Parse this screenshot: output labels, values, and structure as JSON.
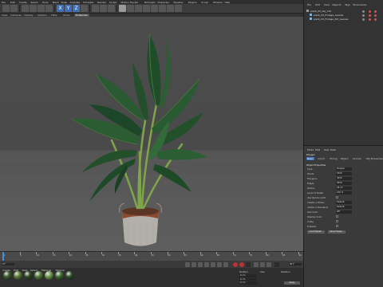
{
  "menus": [
    "File",
    "Edit",
    "Create",
    "Select",
    "Tools",
    "Mesh",
    "Snap",
    "Animate",
    "Simulate",
    "Render",
    "Sculpt",
    "Motion Tracker",
    "MoGraph",
    "Character",
    "Pipeline",
    "Plugins",
    "Script",
    "Window",
    "Help"
  ],
  "toolbar": {
    "x_label": "X",
    "y_label": "Y",
    "z_label": "Z"
  },
  "viewport": {
    "tabs": [
      "View",
      "Cameras",
      "Display",
      "Options",
      "Filter",
      "Panel",
      "ProRender"
    ],
    "active_tab": "ProRender"
  },
  "object_manager": {
    "menus": [
      "File",
      "Edit",
      "View",
      "Objects",
      "Tags",
      "Bookmarks"
    ],
    "objects": [
      {
        "name": "plant_03_obj_c4d",
        "indent": 0
      },
      {
        "name": "plant_03_Foliage_Leaves",
        "indent": 1
      },
      {
        "name": "plant_03_Foliage_Pot_Leaves",
        "indent": 1
      }
    ]
  },
  "attributes": {
    "menus": [
      "Mode",
      "Edit",
      "User Data"
    ],
    "object_title": "Polygon",
    "tabs": [
      "Basic",
      "Coord.",
      "Phong",
      "Object",
      "Include",
      "Obj.Properties"
    ],
    "active_tab": "Basic",
    "section_title": "Object Properties",
    "rows": [
      {
        "label": "Type",
        "value": "Polygon"
      },
      {
        "label": "Points",
        "value": "5340"
      },
      {
        "label": "Polygons",
        "value": "4200"
      },
      {
        "label": "Edges",
        "value": "9540"
      },
      {
        "label": "Radius",
        "value": "28 cm"
      },
      {
        "label": "Level of Detail",
        "value": "100 %"
      },
      {
        "label": "Use Render LOD",
        "value": ""
      },
      {
        "label": "Visible in Editor",
        "value": "Default"
      },
      {
        "label": "Visible in Renderer",
        "value": "Default"
      },
      {
        "label": "Use Color",
        "value": "Off"
      },
      {
        "label": "Display Color",
        "value": ""
      },
      {
        "label": "X-Ray",
        "value": ""
      },
      {
        "label": "Enabled",
        "value": ""
      }
    ],
    "buttons": [
      "Load Preset...",
      "Save Preset..."
    ]
  },
  "timeline": {
    "ticks": [
      "0",
      "5",
      "10",
      "15",
      "20",
      "25",
      "30",
      "35",
      "40",
      "45",
      "50",
      "55",
      "60",
      "65",
      "70",
      "75",
      "80",
      "85",
      "90"
    ],
    "current_frame": "0 F",
    "end_frame": "90 F"
  },
  "materials": {
    "menus": [
      "Create",
      "Edit",
      "View",
      "Select",
      "Material",
      "Texture"
    ],
    "ball_colors": [
      "#3c5a2e",
      "#5e7c38",
      "#2d4a25",
      "#4e7b3a",
      "#6d9a4f",
      "#3d6b30",
      "#2b4d26"
    ]
  },
  "coords": {
    "labels": [
      "Position",
      "Size",
      "Rotation"
    ],
    "x": "0 cm",
    "y": "0 cm",
    "z": "0 cm",
    "apply_label": "Apply"
  }
}
